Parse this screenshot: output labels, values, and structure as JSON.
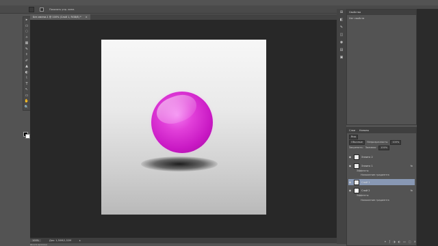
{
  "menu": {
    "items": [
      "",
      "",
      "",
      "",
      "",
      "",
      "",
      "",
      "",
      "",
      ""
    ]
  },
  "options": {
    "tool_label": "",
    "size_value": "",
    "antialias_label": "Автоматически ...",
    "feather_label": "",
    "checkbox_label": "Показать упр. элем."
  },
  "tools": [
    "▸",
    "▭",
    "◌",
    "✧",
    "▦",
    "✎",
    "⚕",
    "✐",
    "▲",
    "◐",
    "⌇",
    "T",
    "↖",
    "▭",
    "✋",
    "🔍"
  ],
  "colors": {
    "accent_ball": "#d22bcf",
    "layer_selected": "#8898b4",
    "canvas_bg": "#282828"
  },
  "document": {
    "tab_title": "Без имени-1 @ 100% (Слой 1, RGB/8) *",
    "close_glyph": "×"
  },
  "status": {
    "zoom": "100%",
    "doc_info": "Док: 1,50M/1,52M",
    "arrow": "▸",
    "bottom_label": "Шкала времени"
  },
  "properties": {
    "title": "Свойства",
    "empty_text": "Нет свойств"
  },
  "layers": {
    "tabs": [
      "Слои",
      "Каналы"
    ],
    "filter_label": "Вид",
    "blend_mode": "Обычные",
    "opacity_label": "Непрозрачность:",
    "opacity_value": "100%",
    "lock_label": "Закрепить:",
    "fill_label": "Заливка:",
    "fill_value": "100%",
    "items": [
      {
        "name": "Эллипс 2"
      },
      {
        "name": "Эллипс 1"
      },
      {
        "name": "Эффекты"
      },
      {
        "name": "Наложение градиента"
      },
      {
        "name": "Слой 1"
      },
      {
        "name": "Слой 2"
      },
      {
        "name": "Эффекты"
      },
      {
        "name": "Наложение градиента"
      }
    ],
    "fx": "fx"
  },
  "dock_icons": [
    "⊞",
    "◧",
    "✎",
    "◫",
    "◉",
    "▤",
    "▣"
  ]
}
